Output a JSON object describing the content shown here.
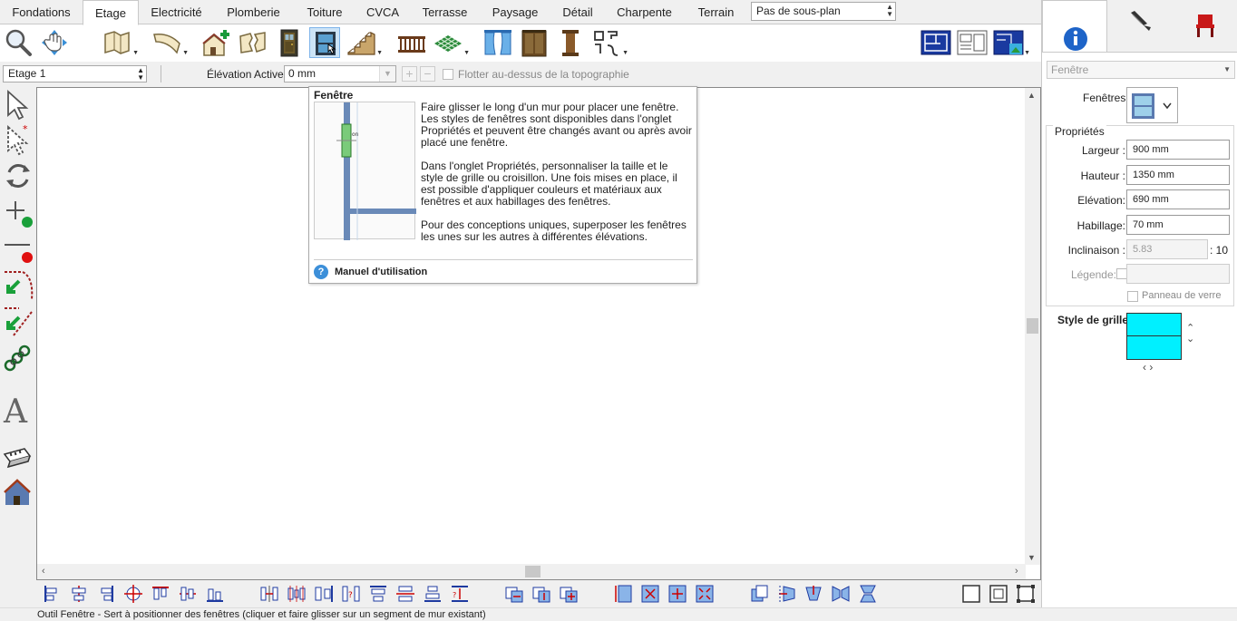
{
  "tabs": [
    {
      "label": "Fondations"
    },
    {
      "label": "Etage"
    },
    {
      "label": "Electricité"
    },
    {
      "label": "Plomberie"
    },
    {
      "label": "Toiture"
    },
    {
      "label": "CVCA"
    },
    {
      "label": "Terrasse"
    },
    {
      "label": "Paysage"
    },
    {
      "label": "Détail"
    },
    {
      "label": "Charpente"
    },
    {
      "label": "Terrain"
    }
  ],
  "active_tab": "Etage",
  "subplan_select": {
    "value": "Pas de sous-plan"
  },
  "options_bar": {
    "floor": "Etage 1",
    "elevation_label": "Élévation Active:",
    "elevation_value": "0 mm",
    "float_label": "Flotter au-dessus de la topographie"
  },
  "tooltip": {
    "title": "Fenêtre",
    "paragraphs": [
      "Faire glisser le long d'un mur pour placer une fenêtre. Les styles de fenêtres sont disponibles dans l'onglet Propriétés et peuvent être changés avant ou après avoir placé une fenêtre.",
      "Dans l'onglet Propriétés, personnaliser la taille et le style de grille ou croisillon. Une fois mises en place, il est possible d'appliquer couleurs et matériaux aux fenêtres et aux habillages des fenêtres.",
      "Pour des conceptions uniques, superposer les fenêtres les unes sur les autres à différentes élévations."
    ],
    "help_link": "Manuel d'utilisation",
    "image_label": "on"
  },
  "right_panel": {
    "type_select": "Fenêtre",
    "windows_label": "Fenêtres",
    "properties_title": "Propriétés",
    "fields": [
      {
        "label": "Largeur :",
        "value": "900 mm"
      },
      {
        "label": "Hauteur :",
        "value": "1350 mm"
      },
      {
        "label": "Elévation:",
        "value": "690 mm"
      },
      {
        "label": "Habillage:",
        "value": "70 mm"
      }
    ],
    "inclinaison": {
      "label": "Inclinaison :",
      "value": "5.83",
      "suffix": ": 10"
    },
    "legende": {
      "label": "Légende:"
    },
    "glass_panel": "Panneau de verre",
    "grid_style_label": "Style de grille:"
  },
  "status": "Outil Fenêtre - Sert à  positionner des fenêtres  (cliquer et faire glisser sur un segment de mur existant)",
  "colors": {
    "accent": "#1e64c8",
    "grid_swatch": "#00f0ff",
    "window_blue": "#4a7fb5"
  },
  "icons": {
    "toolbar": [
      "magnifier-icon",
      "pan-icon",
      "drawing-sheet-icon",
      "curve-icon",
      "add-house-icon",
      "wall-break-icon",
      "door-icon",
      "window-icon",
      "stairs-icon",
      "railing-icon",
      "floor-pattern-icon",
      "curtain-icon",
      "cabinet-icon",
      "column-icon",
      "shapes-icon",
      "plan-view-icon",
      "elevation-view-icon",
      "3d-view-icon"
    ],
    "left": [
      "select-arrow-icon",
      "multi-select-icon",
      "rotate-icon",
      "add-point-icon",
      "delete-point-icon",
      "snap-icon",
      "snap-angle-icon",
      "chain-icon",
      "text-icon",
      "camera-icon",
      "house-icon"
    ]
  }
}
